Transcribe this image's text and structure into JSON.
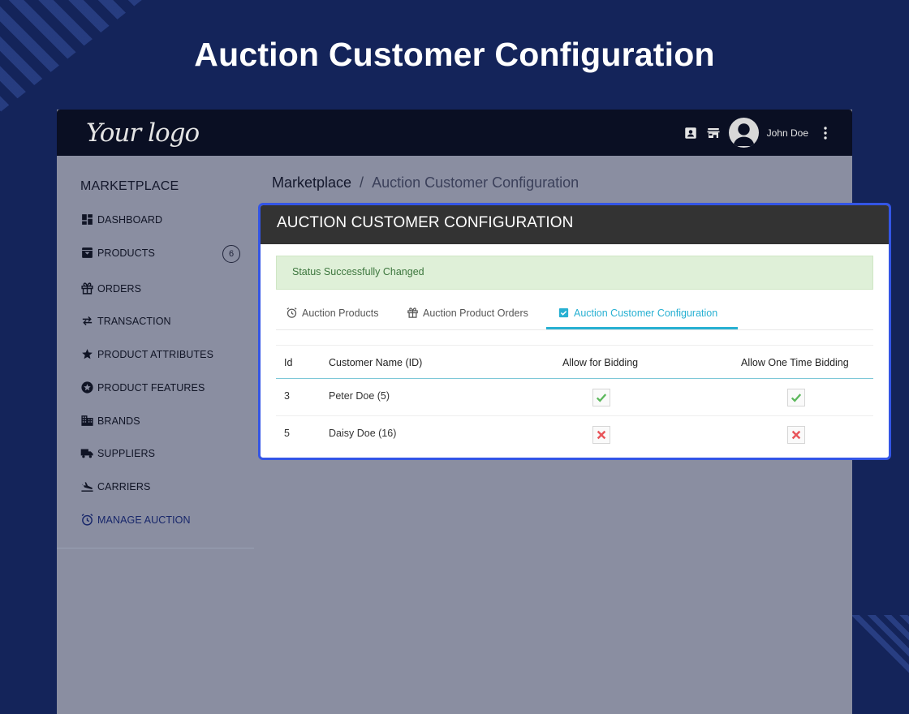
{
  "hero": {
    "title": "Auction Customer Configuration"
  },
  "topbar": {
    "logo": "Your logo",
    "user_name": "John Doe",
    "icons": [
      "contact-card-icon",
      "store-icon",
      "avatar",
      "kebab-menu-icon"
    ]
  },
  "sidebar": {
    "title": "MARKETPLACE",
    "items": [
      {
        "label": "DASHBOARD",
        "icon": "dashboard-icon"
      },
      {
        "label": "PRODUCTS",
        "icon": "archive-box-icon",
        "badge": "6"
      },
      {
        "label": "ORDERS",
        "icon": "gift-icon"
      },
      {
        "label": "TRANSACTION",
        "icon": "swap-arrows-icon"
      },
      {
        "label": "PRODUCT ATTRIBUTES",
        "icon": "star-sparkle-icon"
      },
      {
        "label": "PRODUCT FEATURES",
        "icon": "star-circle-icon"
      },
      {
        "label": "BRANDS",
        "icon": "building-icon"
      },
      {
        "label": "SUPPLIERS",
        "icon": "truck-icon"
      },
      {
        "label": "CARRIERS",
        "icon": "plane-landing-icon"
      },
      {
        "label": "MANAGE AUCTION",
        "icon": "alarm-clock-icon",
        "active": true
      }
    ]
  },
  "breadcrumb": {
    "root": "Marketplace",
    "separator": "/",
    "current": "Auction Customer Configuration"
  },
  "panel": {
    "title": "AUCTION CUSTOMER CONFIGURATION",
    "alert": "Status Successfully Changed",
    "tabs": [
      {
        "label": "Auction Products",
        "icon": "alarm-clock-icon"
      },
      {
        "label": "Auction Product Orders",
        "icon": "gift-icon"
      },
      {
        "label": "Auction Customer Configuration",
        "icon": "checkbox-checked-icon",
        "active": true
      }
    ],
    "table": {
      "columns": [
        "Id",
        "Customer Name (ID)",
        "Allow for Bidding",
        "Allow One Time Bidding"
      ],
      "rows": [
        {
          "id": "3",
          "name": "Peter Doe (5)",
          "allow_bidding": true,
          "allow_one_time": true
        },
        {
          "id": "5",
          "name": "Daisy Doe (16)",
          "allow_bidding": false,
          "allow_one_time": false
        }
      ]
    }
  },
  "colors": {
    "page_bg": "#14245a",
    "accent": "#27b0d2",
    "panel_border": "#3355e6",
    "success_bg": "#dff0d8",
    "success_text": "#3c763d",
    "check_green": "#5cb85c",
    "cross_red": "#e8555a"
  }
}
